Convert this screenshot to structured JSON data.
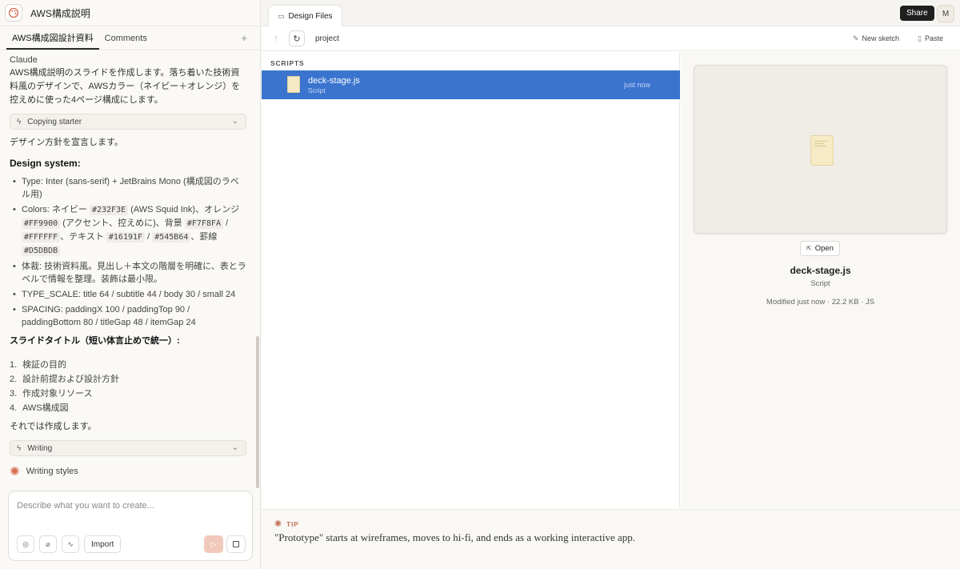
{
  "project": {
    "title": "AWS構成説明"
  },
  "left_tabs": [
    {
      "label": "AWS構成図設計資料"
    },
    {
      "label": "Comments"
    }
  ],
  "left_tab_add": "+",
  "chat": {
    "sender": "Claude",
    "intro": "AWS構成説明のスライドを作成します。落ち着いた技術資料風のデザインで、AWSカラー（ネイビー＋オレンジ）を控えめに使った4ページ構成にします。",
    "tool1": "Copying starter",
    "declare": "デザイン方針を宣言します。",
    "design_heading": "Design system:",
    "type_item": "Type: Inter (sans-serif) + JetBrains Mono (構成図のラベル用)",
    "colors": {
      "prefix": "Colors: ネイビー ",
      "navy": "#232F3E",
      "t1": " (AWS Squid Ink)、オレンジ ",
      "orange": "#FF9900",
      "t2": " (アクセント、控えめに)、背景 ",
      "bg1": "#F7F8FA",
      "sep1": " / ",
      "bg2": "#FFFFFF",
      "t3": "、テキスト ",
      "text1": "#16191F",
      "sep2": " / ",
      "text2": "#545B64",
      "t4": "、罫線 ",
      "rule": "#D5DBDB"
    },
    "style_item": "体裁: 技術資料風。見出し＋本文の階層を明確に、表とラベルで情報を整理。装飾は最小限。",
    "type_scale": "TYPE_SCALE: title 64 / subtitle 44 / body 30 / small 24",
    "spacing": "SPACING: paddingX 100 / paddingTop 90 / paddingBottom 80 / titleGap 48 / itemGap 24",
    "slide_heading": "スライドタイトル（短い体言止めで統一）:",
    "slides": [
      {
        "num": "1.",
        "title": "検証の目的"
      },
      {
        "num": "2.",
        "title": "設計前提および設計方針"
      },
      {
        "num": "3.",
        "title": "作成対象リソース"
      },
      {
        "num": "4.",
        "title": "AWS構成図"
      }
    ],
    "closing": "それでは作成します。",
    "tool2": "Writing",
    "writing_styles": "Writing styles"
  },
  "composer": {
    "placeholder": "Describe what you want to create...",
    "import_label": "Import"
  },
  "right": {
    "tab_label": "Design Files",
    "share_label": "Share",
    "avatar_initial": "M",
    "path": "project",
    "new_sketch": "New sketch",
    "paste": "Paste",
    "section": "SCRIPTS",
    "file": {
      "name": "deck-stage.js",
      "type": "Script",
      "time": "just now"
    },
    "preview": {
      "open_label": "Open",
      "name": "deck-stage.js",
      "type": "Script",
      "meta": "Modified just now · 22.2 KB · JS"
    },
    "tip": {
      "label": "TIP",
      "text": "\"Prototype\" starts at wireframes, moves to hi-fi, and ends as a working interactive app."
    }
  },
  "colors": {
    "accent_blue": "#3b74cf",
    "spark_orange": "#d76c4e"
  }
}
